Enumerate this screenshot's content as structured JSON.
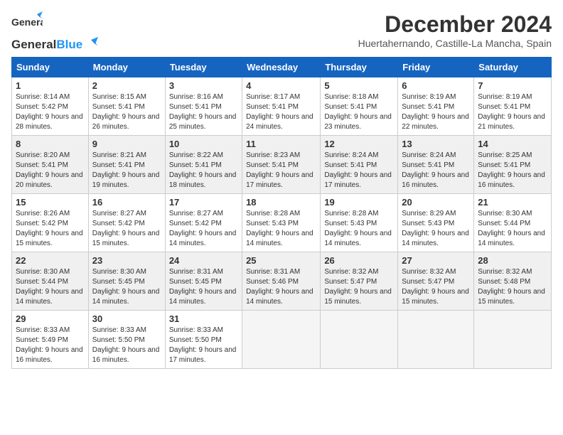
{
  "header": {
    "logo_general": "General",
    "logo_blue": "Blue",
    "month_title": "December 2024",
    "location": "Huertahernando, Castille-La Mancha, Spain"
  },
  "weekdays": [
    "Sunday",
    "Monday",
    "Tuesday",
    "Wednesday",
    "Thursday",
    "Friday",
    "Saturday"
  ],
  "weeks": [
    [
      {
        "day": "1",
        "sunrise": "8:14 AM",
        "sunset": "5:42 PM",
        "daylight": "9 hours and 28 minutes."
      },
      {
        "day": "2",
        "sunrise": "8:15 AM",
        "sunset": "5:41 PM",
        "daylight": "9 hours and 26 minutes."
      },
      {
        "day": "3",
        "sunrise": "8:16 AM",
        "sunset": "5:41 PM",
        "daylight": "9 hours and 25 minutes."
      },
      {
        "day": "4",
        "sunrise": "8:17 AM",
        "sunset": "5:41 PM",
        "daylight": "9 hours and 24 minutes."
      },
      {
        "day": "5",
        "sunrise": "8:18 AM",
        "sunset": "5:41 PM",
        "daylight": "9 hours and 23 minutes."
      },
      {
        "day": "6",
        "sunrise": "8:19 AM",
        "sunset": "5:41 PM",
        "daylight": "9 hours and 22 minutes."
      },
      {
        "day": "7",
        "sunrise": "8:19 AM",
        "sunset": "5:41 PM",
        "daylight": "9 hours and 21 minutes."
      }
    ],
    [
      {
        "day": "8",
        "sunrise": "8:20 AM",
        "sunset": "5:41 PM",
        "daylight": "9 hours and 20 minutes."
      },
      {
        "day": "9",
        "sunrise": "8:21 AM",
        "sunset": "5:41 PM",
        "daylight": "9 hours and 19 minutes."
      },
      {
        "day": "10",
        "sunrise": "8:22 AM",
        "sunset": "5:41 PM",
        "daylight": "9 hours and 18 minutes."
      },
      {
        "day": "11",
        "sunrise": "8:23 AM",
        "sunset": "5:41 PM",
        "daylight": "9 hours and 17 minutes."
      },
      {
        "day": "12",
        "sunrise": "8:24 AM",
        "sunset": "5:41 PM",
        "daylight": "9 hours and 17 minutes."
      },
      {
        "day": "13",
        "sunrise": "8:24 AM",
        "sunset": "5:41 PM",
        "daylight": "9 hours and 16 minutes."
      },
      {
        "day": "14",
        "sunrise": "8:25 AM",
        "sunset": "5:41 PM",
        "daylight": "9 hours and 16 minutes."
      }
    ],
    [
      {
        "day": "15",
        "sunrise": "8:26 AM",
        "sunset": "5:42 PM",
        "daylight": "9 hours and 15 minutes."
      },
      {
        "day": "16",
        "sunrise": "8:27 AM",
        "sunset": "5:42 PM",
        "daylight": "9 hours and 15 minutes."
      },
      {
        "day": "17",
        "sunrise": "8:27 AM",
        "sunset": "5:42 PM",
        "daylight": "9 hours and 14 minutes."
      },
      {
        "day": "18",
        "sunrise": "8:28 AM",
        "sunset": "5:43 PM",
        "daylight": "9 hours and 14 minutes."
      },
      {
        "day": "19",
        "sunrise": "8:28 AM",
        "sunset": "5:43 PM",
        "daylight": "9 hours and 14 minutes."
      },
      {
        "day": "20",
        "sunrise": "8:29 AM",
        "sunset": "5:43 PM",
        "daylight": "9 hours and 14 minutes."
      },
      {
        "day": "21",
        "sunrise": "8:30 AM",
        "sunset": "5:44 PM",
        "daylight": "9 hours and 14 minutes."
      }
    ],
    [
      {
        "day": "22",
        "sunrise": "8:30 AM",
        "sunset": "5:44 PM",
        "daylight": "9 hours and 14 minutes."
      },
      {
        "day": "23",
        "sunrise": "8:30 AM",
        "sunset": "5:45 PM",
        "daylight": "9 hours and 14 minutes."
      },
      {
        "day": "24",
        "sunrise": "8:31 AM",
        "sunset": "5:45 PM",
        "daylight": "9 hours and 14 minutes."
      },
      {
        "day": "25",
        "sunrise": "8:31 AM",
        "sunset": "5:46 PM",
        "daylight": "9 hours and 14 minutes."
      },
      {
        "day": "26",
        "sunrise": "8:32 AM",
        "sunset": "5:47 PM",
        "daylight": "9 hours and 15 minutes."
      },
      {
        "day": "27",
        "sunrise": "8:32 AM",
        "sunset": "5:47 PM",
        "daylight": "9 hours and 15 minutes."
      },
      {
        "day": "28",
        "sunrise": "8:32 AM",
        "sunset": "5:48 PM",
        "daylight": "9 hours and 15 minutes."
      }
    ],
    [
      {
        "day": "29",
        "sunrise": "8:33 AM",
        "sunset": "5:49 PM",
        "daylight": "9 hours and 16 minutes."
      },
      {
        "day": "30",
        "sunrise": "8:33 AM",
        "sunset": "5:50 PM",
        "daylight": "9 hours and 16 minutes."
      },
      {
        "day": "31",
        "sunrise": "8:33 AM",
        "sunset": "5:50 PM",
        "daylight": "9 hours and 17 minutes."
      },
      null,
      null,
      null,
      null
    ]
  ]
}
